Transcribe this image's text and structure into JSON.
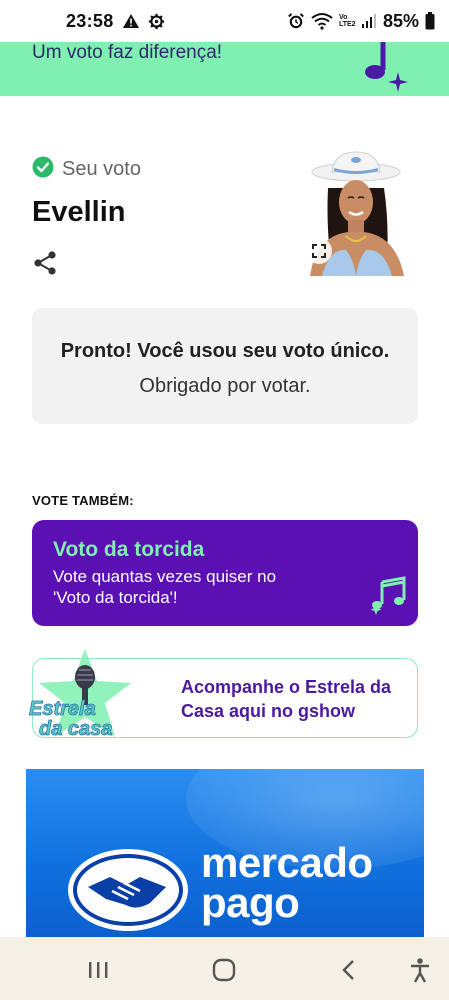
{
  "status_bar": {
    "time": "23:58",
    "battery": "85%",
    "network": "Vo LTE2"
  },
  "top_banner": {
    "text": "Um voto faz diferença!"
  },
  "vote": {
    "check_label": "Seu voto",
    "name": "Evellin"
  },
  "confirmation": {
    "bold_text": "Pronto! Você usou seu voto único.",
    "regular_text": "Obrigado por votar."
  },
  "also_vote": {
    "label": "VOTE TAMBÉM:"
  },
  "torcida": {
    "title": "Voto da torcida",
    "subtitle": "Vote quantas vezes quiser no 'Voto da torcida'!"
  },
  "estrela": {
    "logo_text_line1": "Estrela",
    "logo_text_line2": "da casa",
    "text": "Acompanhe o Estrela da Casa aqui no gshow"
  },
  "ad": {
    "brand_line1": "mercado",
    "brand_line2": "pago"
  },
  "colors": {
    "mint": "#7ff0b0",
    "purple": "#5a10b3",
    "ad_blue": "#1171de"
  }
}
